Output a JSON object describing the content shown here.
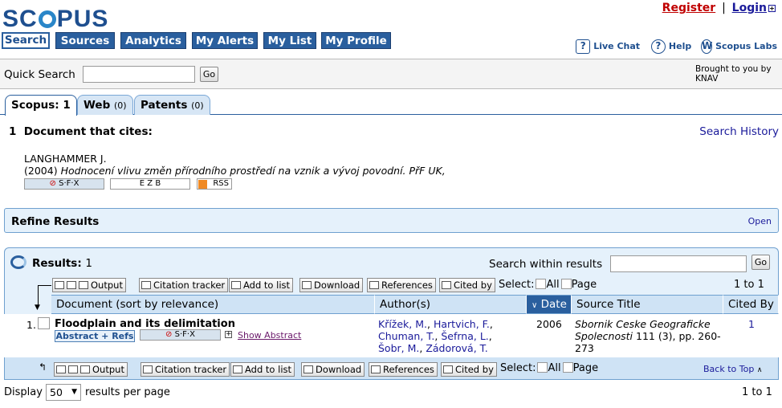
{
  "brand": {
    "logo_pre": "SC",
    "logo_post": "PUS"
  },
  "top_links": {
    "register": "Register",
    "separator": "|",
    "login": "Login"
  },
  "nav": {
    "tabs": [
      {
        "label": "Search",
        "active": true
      },
      {
        "label": "Sources"
      },
      {
        "label": "Analytics"
      },
      {
        "label": "My Alerts"
      },
      {
        "label": "My List"
      },
      {
        "label": "My Profile"
      }
    ]
  },
  "utility": {
    "live_chat": "Live Chat",
    "help": "Help",
    "labs": "Scopus Labs"
  },
  "quick_search": {
    "label": "Quick Search",
    "value": "",
    "go": "Go",
    "brought_line1": "Brought to you by",
    "brought_line2": "KNAV"
  },
  "result_tabs": {
    "scopus": {
      "label": "Scopus:",
      "count": "1"
    },
    "web": {
      "label": "Web",
      "count": "(0)"
    },
    "patents": {
      "label": "Patents",
      "count": "(0)"
    }
  },
  "cited_doc": {
    "count_text": "1  Document that cites:",
    "search_history": "Search History",
    "author": "LANGHAMMER J.",
    "year": "(2004)",
    "title": "Hodnocení vlivu změn přírodního prostředí na vznik a vývoj povodní. PřF UK,",
    "sfx": "S·F·X",
    "ezb": "E Z B",
    "rss": "RSS"
  },
  "refine": {
    "title": "Refine Results",
    "open": "Open"
  },
  "results": {
    "label": "Results:",
    "count": "1",
    "search_within_label": "Search within results",
    "search_within_value": "",
    "go": "Go",
    "toolbar": {
      "output": "Output",
      "citation_tracker": "Citation tracker",
      "add_to_list": "Add to list",
      "download": "Download",
      "references": "References",
      "cited_by": "Cited by",
      "select": "Select:",
      "all": "All",
      "page": "Page",
      "range": "1 to 1"
    },
    "columns": {
      "document": "Document (sort by relevance)",
      "authors": "Author(s)",
      "date": "Date",
      "source": "Source Title",
      "cited_by": "Cited By"
    },
    "rows": [
      {
        "num": "1.",
        "title": "Floodplain and its delimitation",
        "abstract_refs": "Abstract + Refs",
        "sfx": "S·F·X",
        "show_abstract": "Show Abstract",
        "authors": [
          "Křížek, M.",
          "Hartvich, F.",
          "Chuman, T.",
          "Šefrna, L.",
          "Šobr, M.",
          "Zádorová, T."
        ],
        "date": "2006",
        "source_title": "Sbornik Ceske Geograficke Spolecnosti",
        "source_rest": "111 (3), pp. 260-273",
        "cited_by": "1"
      }
    ],
    "back_to_top": "Back to Top",
    "display_label": "Display",
    "per_page": "50",
    "per_page_suffix": "results per page",
    "footer_range": "1 to 1"
  }
}
